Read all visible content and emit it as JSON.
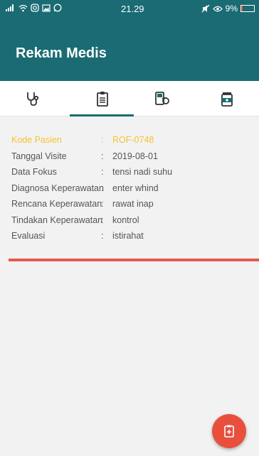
{
  "status_bar": {
    "time": "21.29",
    "battery": "9%",
    "battery_level": 0.09
  },
  "app_bar": {
    "title": "Rekam Medis"
  },
  "tabs": [
    {
      "icon": "stethoscope-icon",
      "selected": false
    },
    {
      "icon": "clipboard-icon",
      "selected": true
    },
    {
      "icon": "blood-pressure-icon",
      "selected": false
    },
    {
      "icon": "medicine-icon",
      "selected": false
    }
  ],
  "record": [
    {
      "label": "Kode Pasien",
      "value": "ROF-0748"
    },
    {
      "label": "Tanggal Visite",
      "value": "2019-08-01"
    },
    {
      "label": "Data Fokus",
      "value": "tensi nadi suhu"
    },
    {
      "label": "Diagnosa Keperawatan",
      "value": "enter whind"
    },
    {
      "label": "Rencana Keperawatan",
      "value": "rawat inap"
    },
    {
      "label": "Tindakan Keperawatan",
      "value": "kontrol"
    },
    {
      "label": "Evaluasi",
      "value": "istirahat"
    }
  ],
  "separator": ":",
  "colors": {
    "primary": "#1a6b73",
    "highlight": "#f4c430",
    "accent": "#e8503d"
  },
  "fab": {
    "icon": "add-document-icon"
  }
}
